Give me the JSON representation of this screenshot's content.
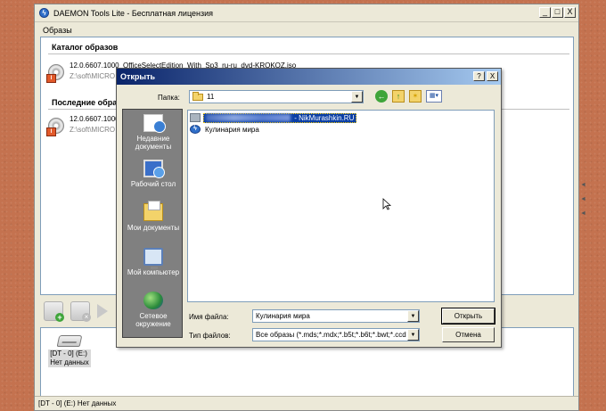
{
  "main_window": {
    "title": "DAEMON Tools Lite - Бесплатная лицензия",
    "icon": "daemon-tools-bolt-icon",
    "menu": {
      "images": "Образы"
    },
    "catalog_header": "Каталог образов",
    "recent_header": "Последние обра",
    "catalog_items": [
      {
        "name": "12.0.6607.1000_OfficeSelectEdition_With_Sp3_ru-ru_dvd-KROKOZ.iso",
        "path": "Z:\\soft\\MICRO"
      }
    ],
    "recent_items": [
      {
        "name": "12.0.6607.1000",
        "path": "Z:\\soft\\MICRO"
      }
    ],
    "drive": {
      "id": "[DT - 0] (E:)",
      "state": "Нет данных"
    },
    "status": "[DT - 0] (E:) Нет данных",
    "window_controls": {
      "minimize": "_",
      "maximize": "□",
      "close": "X"
    }
  },
  "open_dialog": {
    "title": "Открыть",
    "help_button": "?",
    "close_button": "X",
    "folder_label": "Папка:",
    "folder_value": "11",
    "places": [
      {
        "label": "Недавние документы",
        "icon": "recent-documents-icon"
      },
      {
        "label": "Рабочий стол",
        "icon": "desktop-icon"
      },
      {
        "label": "Мои документы",
        "icon": "my-documents-icon"
      },
      {
        "label": "Мой компьютер",
        "icon": "my-computer-icon"
      },
      {
        "label": "Сетевое окружение",
        "icon": "network-icon"
      }
    ],
    "files": [
      {
        "name": "NikMurashkin.RU",
        "prefix": " - ",
        "icon": "folder-icon",
        "selected": true,
        "partially_obscured": true
      },
      {
        "name": "Кулинария мира",
        "icon": "daemon-image-icon",
        "selected": false
      }
    ],
    "filename_label": "Имя файла:",
    "filename_value": "Кулинария мира",
    "filetype_label": "Тип файлов:",
    "filetype_value": "Все образы (*.mds;*.mdx;*.b5t;*.b6t;*.bwt;*.ccd",
    "open_button": "Открыть",
    "cancel_button": "Отмена",
    "colors": {
      "title_start": "#0a246a",
      "title_end": "#a6caf0",
      "selection": "#0a3fa6"
    }
  }
}
